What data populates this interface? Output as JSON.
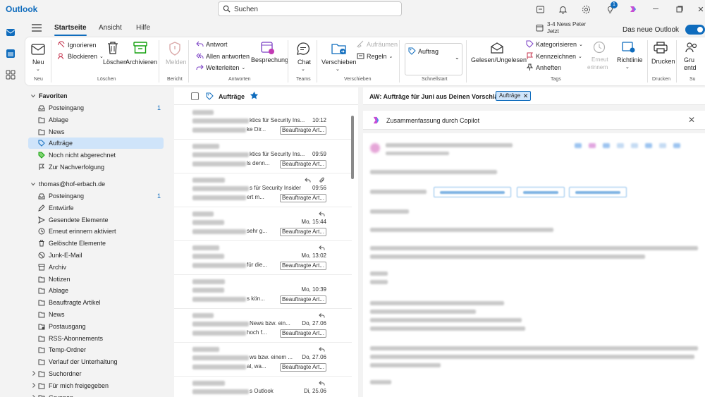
{
  "app": {
    "title": "Outlook"
  },
  "search": {
    "placeholder": "Suchen"
  },
  "topbar": {
    "tips_badge": "1"
  },
  "tabs": [
    "Startseite",
    "Ansicht",
    "Hilfe"
  ],
  "notification": {
    "line1": "3-4 News Peter",
    "line2": "Jetzt"
  },
  "new_outlook": {
    "label": "Das neue Outlook",
    "enabled": true
  },
  "ribbon": {
    "new": {
      "label": "Neu",
      "group": "Neu"
    },
    "ignore": "Ignorieren",
    "block": "Blockieren",
    "delete": "Löschen",
    "archive": "Archivieren",
    "group_delete": "Löschen",
    "report": "Melden",
    "group_report": "Bericht",
    "reply": "Antwort",
    "reply_all": "Allen antworten",
    "forward": "Weiterleiten",
    "meeting": "Besprechung",
    "group_respond": "Antworten",
    "chat": "Chat",
    "group_teams": "Teams",
    "move": "Verschieben",
    "cleanup": "Aufräumen",
    "rules": "Regeln",
    "group_move": "Verschieben",
    "quickstep": "Auftrag",
    "group_quick": "Schnellstart",
    "read_unread": "Gelesen/Ungelesen",
    "categorize": "Kategorisieren",
    "flag": "Kennzeichnen",
    "pin": "Anheften",
    "remind_l1": "Erneut",
    "remind_l2": "erinnern",
    "policy": "Richtlinie",
    "group_tags": "Tags",
    "print": "Drucken",
    "group_print": "Drucken",
    "groups_l1": "Gru",
    "groups_l2": "entd",
    "group_last": "Su"
  },
  "favorites": {
    "header": "Favoriten",
    "items": [
      {
        "label": "Posteingang",
        "count": "1",
        "icon": "inbox-icon"
      },
      {
        "label": "Ablage",
        "count": "",
        "icon": "folder-icon"
      },
      {
        "label": "News",
        "count": "",
        "icon": "folder-icon"
      },
      {
        "label": "Aufträge",
        "count": "",
        "icon": "tag-icon"
      },
      {
        "label": "Noch nicht abgerechnet",
        "count": "",
        "icon": "tag-green-icon"
      },
      {
        "label": "Zur Nachverfolgung",
        "count": "",
        "icon": "flag-icon"
      }
    ]
  },
  "account": {
    "header": "thomas@hof-erbach.de",
    "items": [
      {
        "label": "Posteingang",
        "count": "1",
        "icon": "inbox-icon"
      },
      {
        "label": "Entwürfe",
        "count": "",
        "icon": "pencil-icon"
      },
      {
        "label": "Gesendete Elemente",
        "count": "",
        "icon": "send-icon"
      },
      {
        "label": "Erneut erinnern aktiviert",
        "count": "",
        "icon": "clock-icon"
      },
      {
        "label": "Gelöschte Elemente",
        "count": "",
        "icon": "trash-icon"
      },
      {
        "label": "Junk-E-Mail",
        "count": "",
        "icon": "junk-icon"
      },
      {
        "label": "Archiv",
        "count": "",
        "icon": "archive-icon"
      },
      {
        "label": "Notizen",
        "count": "",
        "icon": "folder-icon"
      },
      {
        "label": "Ablage",
        "count": "",
        "icon": "folder-icon"
      },
      {
        "label": "Beauftragte Artikel",
        "count": "",
        "icon": "folder-icon"
      },
      {
        "label": "News",
        "count": "",
        "icon": "folder-icon"
      },
      {
        "label": "Postausgang",
        "count": "",
        "icon": "outbox-icon"
      },
      {
        "label": "RSS-Abonnements",
        "count": "",
        "icon": "folder-icon"
      },
      {
        "label": "Temp-Ordner",
        "count": "",
        "icon": "folder-icon"
      },
      {
        "label": "Verlauf der Unterhaltung",
        "count": "",
        "icon": "folder-icon"
      }
    ]
  },
  "extra_folders": [
    {
      "label": "Suchordner"
    },
    {
      "label": "Für mich freigegeben"
    },
    {
      "label": "Gruppen"
    }
  ],
  "list": {
    "header": "Aufträge",
    "rows": [
      {
        "subject_tail": "ktics für Security Ins...",
        "preview_tail": "ke Dir...",
        "time": "10:12",
        "tag": "Beauftragte Art...",
        "reply": false,
        "attach": false
      },
      {
        "subject_tail": "ktics für Security Ins...",
        "preview_tail": "ls denn...",
        "time": "09:59",
        "tag": "Beauftragte Art...",
        "reply": false,
        "attach": false
      },
      {
        "subject_tail": "s für Security Insider",
        "preview_tail": "ert m...",
        "time": "09:56",
        "tag": "Beauftragte Art...",
        "reply": true,
        "attach": true
      },
      {
        "subject_tail": "",
        "preview_tail": "sehr g...",
        "time": "Mo, 15:44",
        "tag": "Beauftragte Art...",
        "reply": true,
        "attach": false
      },
      {
        "subject_tail": "",
        "preview_tail": "für die...",
        "time": "Mo, 13:02",
        "tag": "Beauftragte Art...",
        "reply": true,
        "attach": false
      },
      {
        "subject_tail": "",
        "preview_tail": "s kön...",
        "time": "Mo, 10:39",
        "tag": "Beauftragte Art...",
        "reply": false,
        "attach": false
      },
      {
        "subject_tail": "News bzw. ein...",
        "preview_tail": "hoch f...",
        "time": "Do, 27.06",
        "tag": "Beauftragte Art...",
        "reply": true,
        "attach": false
      },
      {
        "subject_tail": "ws bzw. einem ...",
        "preview_tail": "al, wa...",
        "time": "Do, 27.06",
        "tag": "Beauftragte Art...",
        "reply": true,
        "attach": false
      },
      {
        "subject_tail": "s Outlook",
        "preview_tail": "",
        "time": "Di, 25.06",
        "tag": "",
        "reply": true,
        "attach": false
      }
    ]
  },
  "reading": {
    "subject": "AW: Aufträge für Juni aus Deinen Vorschlägen",
    "tag": "Aufträge",
    "copilot": "Zusammenfassung durch Copilot"
  },
  "colors": {
    "accent": "#0f6cbd",
    "selected": "#cfe4fa"
  }
}
